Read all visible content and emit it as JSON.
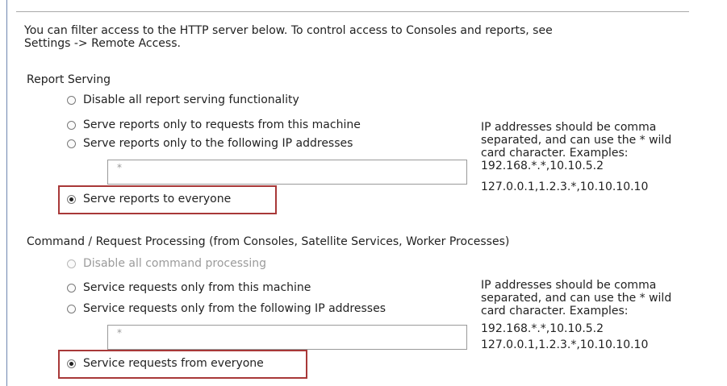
{
  "intro": {
    "line1": "You can filter access to the HTTP server below.  To control access to Consoles and reports, see",
    "line2": "Settings -> Remote Access."
  },
  "report_serving": {
    "heading": "Report Serving",
    "options": [
      {
        "label": "Disable all report serving functionality",
        "checked": false,
        "enabled": true
      },
      {
        "label": "Serve reports only to requests from this machine",
        "checked": false,
        "enabled": true
      },
      {
        "label": "Serve reports only to the following IP addresses",
        "checked": false,
        "enabled": true
      },
      {
        "label": "Serve reports to everyone",
        "checked": true,
        "enabled": true
      }
    ],
    "ip_value": "*",
    "help": [
      "IP addresses should be comma",
      "separated, and can use the * wild",
      "card character.  Examples:",
      "192.168.*.*,10.10.5.2",
      "127.0.0.1,1.2.3.*,10.10.10.10"
    ]
  },
  "command_processing": {
    "heading": "Command / Request Processing  (from Consoles, Satellite Services, Worker Processes)",
    "options": [
      {
        "label": "Disable all command processing",
        "checked": false,
        "enabled": false
      },
      {
        "label": "Service requests only from this machine",
        "checked": false,
        "enabled": true
      },
      {
        "label": "Service requests only from the following IP addresses",
        "checked": false,
        "enabled": true
      },
      {
        "label": "Service requests from everyone",
        "checked": true,
        "enabled": true
      }
    ],
    "ip_value": "*",
    "help": [
      "IP addresses should be comma",
      "separated, and can use the * wild",
      "card character.  Examples:",
      "192.168.*.*,10.10.5.2",
      "127.0.0.1,1.2.3.*,10.10.10.10"
    ]
  }
}
